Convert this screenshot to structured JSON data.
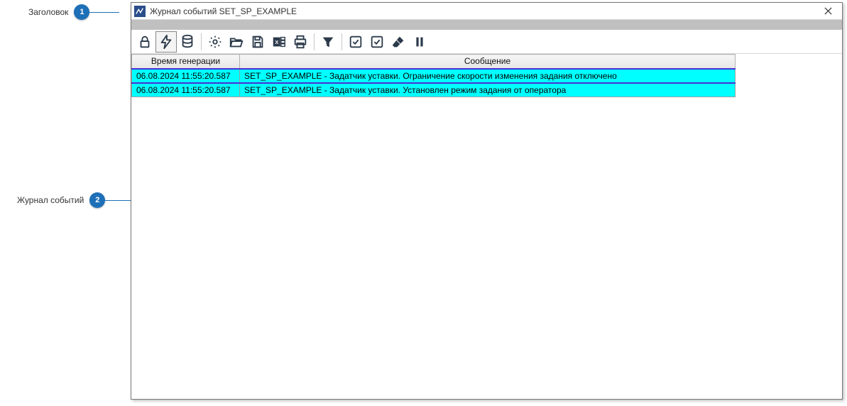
{
  "callouts": {
    "c1": {
      "label": "Заголовок",
      "num": "1"
    },
    "c2": {
      "label": "Журнал событий",
      "num": "2"
    }
  },
  "window": {
    "title": "Журнал событий SET_SP_EXAMPLE"
  },
  "toolbar": {
    "lock": "lock-icon",
    "bolt": "bolt-icon",
    "db": "database-icon",
    "gear": "gear-icon",
    "folder": "folder-open-icon",
    "save": "save-icon",
    "excel": "excel-icon",
    "print": "print-icon",
    "filter": "filter-icon",
    "check1": "check-square-icon",
    "check2": "check-square-icon",
    "erase": "eraser-icon",
    "pause": "pause-icon"
  },
  "columns": {
    "time": "Время генерации",
    "msg": "Сообщение"
  },
  "rows": [
    {
      "time": "06.08.2024 11:55:20.587",
      "msg": "SET_SP_EXAMPLE - Задатчик уставки. Ограничение скорости изменения задания отключено",
      "selected": true
    },
    {
      "time": "06.08.2024 11:55:20.587",
      "msg": "SET_SP_EXAMPLE - Задатчик уставки. Установлен режим задания от оператора",
      "selected": false
    }
  ]
}
